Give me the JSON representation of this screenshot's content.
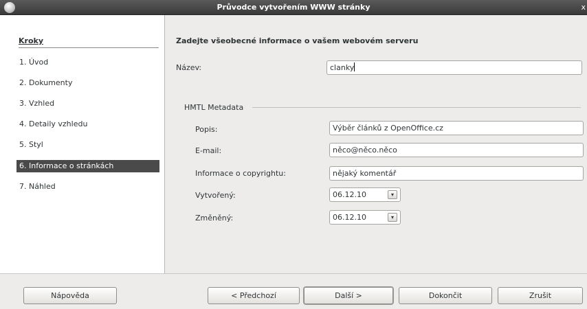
{
  "window": {
    "title": "Průvodce vytvořením WWW stránky",
    "close_label": "x"
  },
  "sidebar": {
    "title": "Kroky",
    "steps": [
      "1. Úvod",
      "2. Dokumenty",
      "3. Vzhled",
      "4. Detaily vzhledu",
      "5. Styl",
      "6. Informace o stránkách",
      "7. Náhled"
    ],
    "active_index": 5
  },
  "main": {
    "heading": "Zadejte všeobecné informace o vašem webovém serveru",
    "name": {
      "label": "Název:",
      "value": "clanky"
    },
    "metadata": {
      "group_label": "HMTL Metadata",
      "description": {
        "label": "Popis:",
        "value": "Výběr článků z OpenOffice.cz"
      },
      "email": {
        "label": "E-mail:",
        "value": "něco@něco.něco"
      },
      "copyright": {
        "label": "Informace o copyrightu:",
        "value": "nějaký komentář"
      },
      "created": {
        "label": "Vytvořený:",
        "value": "06.12.10"
      },
      "modified": {
        "label": "Změněný:",
        "value": "06.12.10"
      }
    }
  },
  "buttons": {
    "help": "Nápověda",
    "back": "< Předchozí",
    "next": "Další >",
    "finish": "Dokončit",
    "cancel": "Zrušit"
  }
}
